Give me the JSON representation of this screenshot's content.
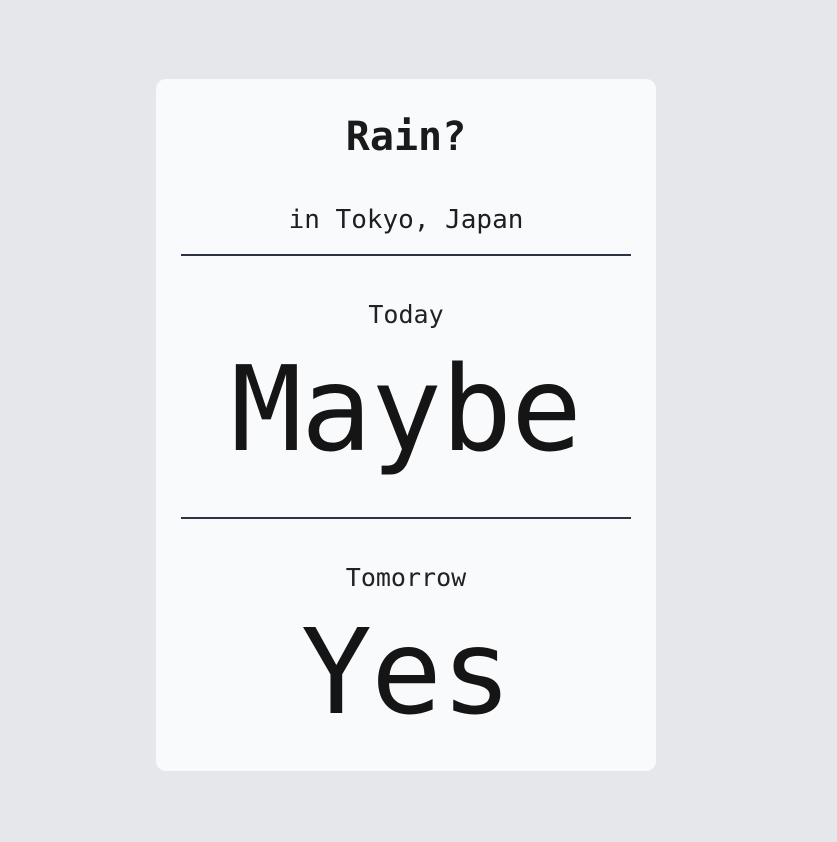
{
  "widget": {
    "title": "Rain?",
    "location": "in Tokyo, Japan",
    "forecast": [
      {
        "day": "Today",
        "answer": "Maybe"
      },
      {
        "day": "Tomorrow",
        "answer": "Yes"
      }
    ]
  },
  "colors": {
    "page_background": "#e6e7ea",
    "card_background": "#f8fafc",
    "divider": "#2c3345",
    "text": "#1b1b1b"
  }
}
